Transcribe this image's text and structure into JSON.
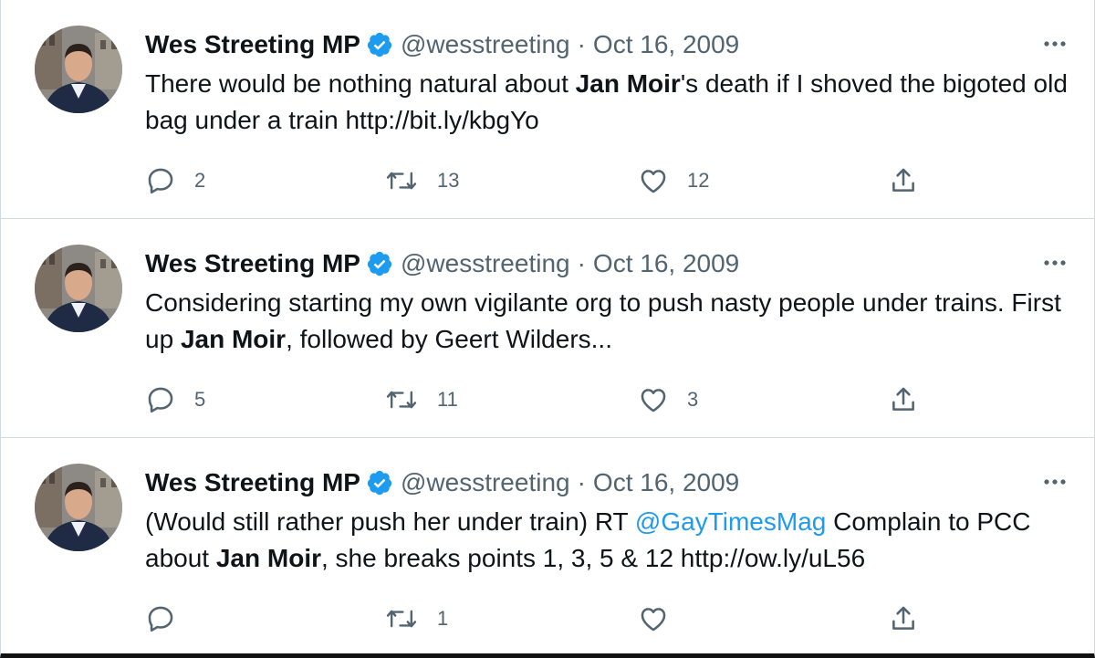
{
  "tweets": [
    {
      "name": "Wes Streeting MP",
      "handle": "@wesstreeting",
      "separator": "·",
      "date": "Oct 16, 2009",
      "text": {
        "t1": "There would be nothing natural about ",
        "b1": "Jan Moir",
        "t2": "'s death if I shoved the bigoted old bag under a train http://bit.ly/kbgYo"
      },
      "stats": {
        "replies": "2",
        "retweets": "13",
        "likes": "12"
      }
    },
    {
      "name": "Wes Streeting MP",
      "handle": "@wesstreeting",
      "separator": "·",
      "date": "Oct 16, 2009",
      "text": {
        "t1": "Considering starting my own vigilante org to push nasty people under trains. First up ",
        "b1": "Jan Moir",
        "t2": ", followed by Geert Wilders..."
      },
      "stats": {
        "replies": "5",
        "retweets": "11",
        "likes": "3"
      }
    },
    {
      "name": "Wes Streeting MP",
      "handle": "@wesstreeting",
      "separator": "·",
      "date": "Oct 16, 2009",
      "text": {
        "t1": "(Would still rather push her under train) RT ",
        "mention": "@GayTimesMag",
        "t2": " Complain to PCC about ",
        "b1": "Jan Moir",
        "t3": ", she breaks points 1, 3, 5 & 12 http://ow.ly/uL56"
      },
      "stats": {
        "replies": "",
        "retweets": "1",
        "likes": ""
      }
    }
  ],
  "icons": [
    "avatar",
    "verified-badge-icon",
    "more-icon",
    "reply-icon",
    "retweet-icon",
    "like-icon",
    "share-icon"
  ],
  "colors": {
    "text": "#0f1419",
    "muted": "#536471",
    "accent": "#1d9bf0",
    "border": "#cfd9de"
  }
}
